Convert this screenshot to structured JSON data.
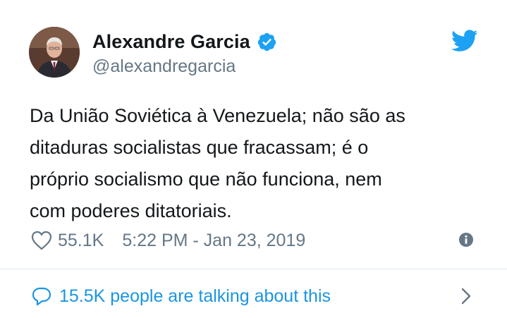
{
  "tweet": {
    "author": {
      "display_name": "Alexandre Garcia",
      "handle": "@alexandregarcia",
      "verified": true
    },
    "text_lines": [
      "Da União Soviética à Venezuela; não são as",
      "ditaduras socialistas que fracassam; é o",
      "próprio socialismo que não funciona, nem",
      "com poderes ditatoriais."
    ],
    "likes": "55.1K",
    "timestamp": "5:22 PM - Jan 23, 2019",
    "conversation_text": "15.5K people are talking about this"
  },
  "icons": {
    "verified": "verified-badge-icon",
    "brand": "twitter-bird-icon",
    "like": "heart-icon",
    "info": "info-icon",
    "conversation": "speech-bubble-icon",
    "chevron": "chevron-right-icon"
  },
  "colors": {
    "brand_blue": "#1da1f2",
    "link_blue": "#1b95e0",
    "secondary_text": "#657786",
    "primary_text": "#14171a",
    "divider": "#e1e8ed"
  }
}
